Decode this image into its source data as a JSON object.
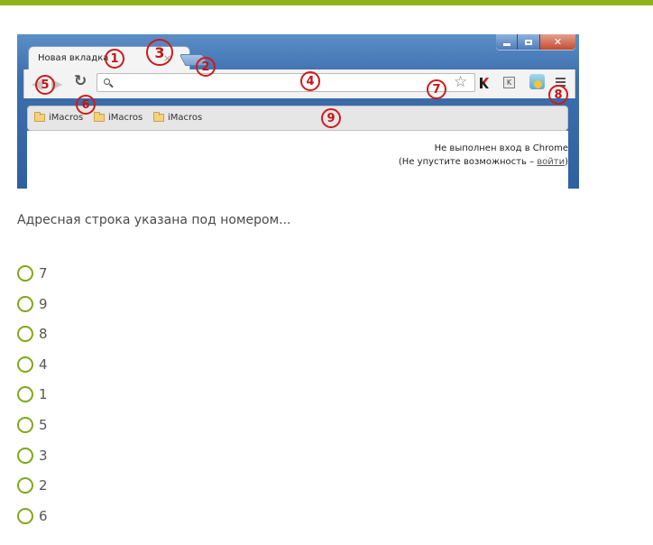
{
  "browser": {
    "tab_title": "Новая вкладка",
    "tab_close": "×",
    "bookmarks": [
      "iMacros",
      "iMacros",
      "iMacros"
    ],
    "signin_line1": "Не выполнен вход в Chrome",
    "signin_line2_prefix": "(Не упустите возможность – ",
    "signin_link": "войти",
    "signin_line2_suffix": ")",
    "ext_k2_label": "K"
  },
  "markers": [
    "1",
    "2",
    "3",
    "4",
    "5",
    "6",
    "7",
    "8",
    "9"
  ],
  "question": "Адресная строка указана под номером...",
  "options": [
    "7",
    "9",
    "8",
    "4",
    "1",
    "5",
    "3",
    "2",
    "6"
  ],
  "colors": {
    "accent_bar": "#8db21a",
    "radio_border": "#7fa81a",
    "marker_red": "#d11a1a",
    "frame_blue": "#3d6fae"
  }
}
